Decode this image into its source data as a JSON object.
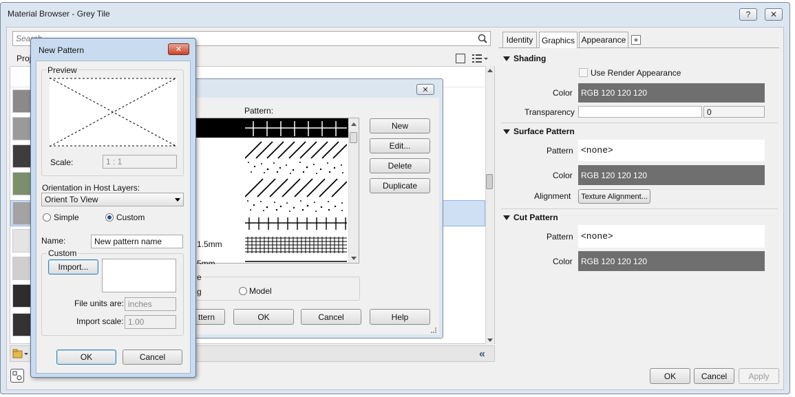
{
  "main_window": {
    "title": "Material Browser - Grey Tile",
    "search_placeholder": "Search",
    "project_label": "Proj",
    "right_tabs": [
      "Identity",
      "Graphics",
      "Appearance"
    ],
    "add_tab": "+",
    "shading": {
      "header": "Shading",
      "use_render_label": "Use Render Appearance",
      "color_label": "Color",
      "color_value": "RGB 120 120 120",
      "transparency_label": "Transparency",
      "transparency_value": "0"
    },
    "surface_pattern": {
      "header": "Surface Pattern",
      "pattern_label": "Pattern",
      "pattern_value": "<none>",
      "color_label": "Color",
      "color_value": "RGB 120 120 120",
      "alignment_label": "Alignment",
      "alignment_button": "Texture Alignment..."
    },
    "cut_pattern": {
      "header": "Cut Pattern",
      "pattern_label": "Pattern",
      "pattern_value": "<none>",
      "color_label": "Color",
      "color_value": "RGB 120 120 120"
    },
    "footer": {
      "ok": "OK",
      "cancel": "Cancel",
      "apply": "Apply"
    },
    "help_icon": "?",
    "close_icon": "✕"
  },
  "fill_patterns_dialog": {
    "pattern_header": "Pattern:",
    "buttons": {
      "new": "New",
      "edit": "Edit...",
      "delete": "Delete",
      "duplicate": "Duplicate"
    },
    "partial_names": [
      "1.5mm",
      "5mm"
    ],
    "type_partial": "e",
    "drafting_partial": "g",
    "model_label": "Model",
    "footer": {
      "pattern_partial": "ttern",
      "ok": "OK",
      "cancel": "Cancel",
      "help": "Help"
    }
  },
  "new_pattern_dialog": {
    "title": "New Pattern",
    "preview_label": "Preview",
    "scale_label": "Scale:",
    "scale_value": "1 : 1",
    "orientation_label": "Orientation in Host Layers:",
    "orientation_value": "Orient To View",
    "simple_label": "Simple",
    "custom_label": "Custom",
    "name_label": "Name:",
    "name_value": "New pattern name",
    "custom_group_label": "Custom",
    "import_button": "Import...",
    "file_units_label": "File units are:",
    "file_units_value": "inches",
    "import_scale_label": "Import scale:",
    "import_scale_value": "1.00",
    "ok": "OK",
    "cancel": "Cancel"
  },
  "colors": {
    "window_bg": "#f0f0f0",
    "titlebar": "#dfe8f3",
    "dark_swatch": "#6f6f6f",
    "selection": "#cfe0f5"
  }
}
